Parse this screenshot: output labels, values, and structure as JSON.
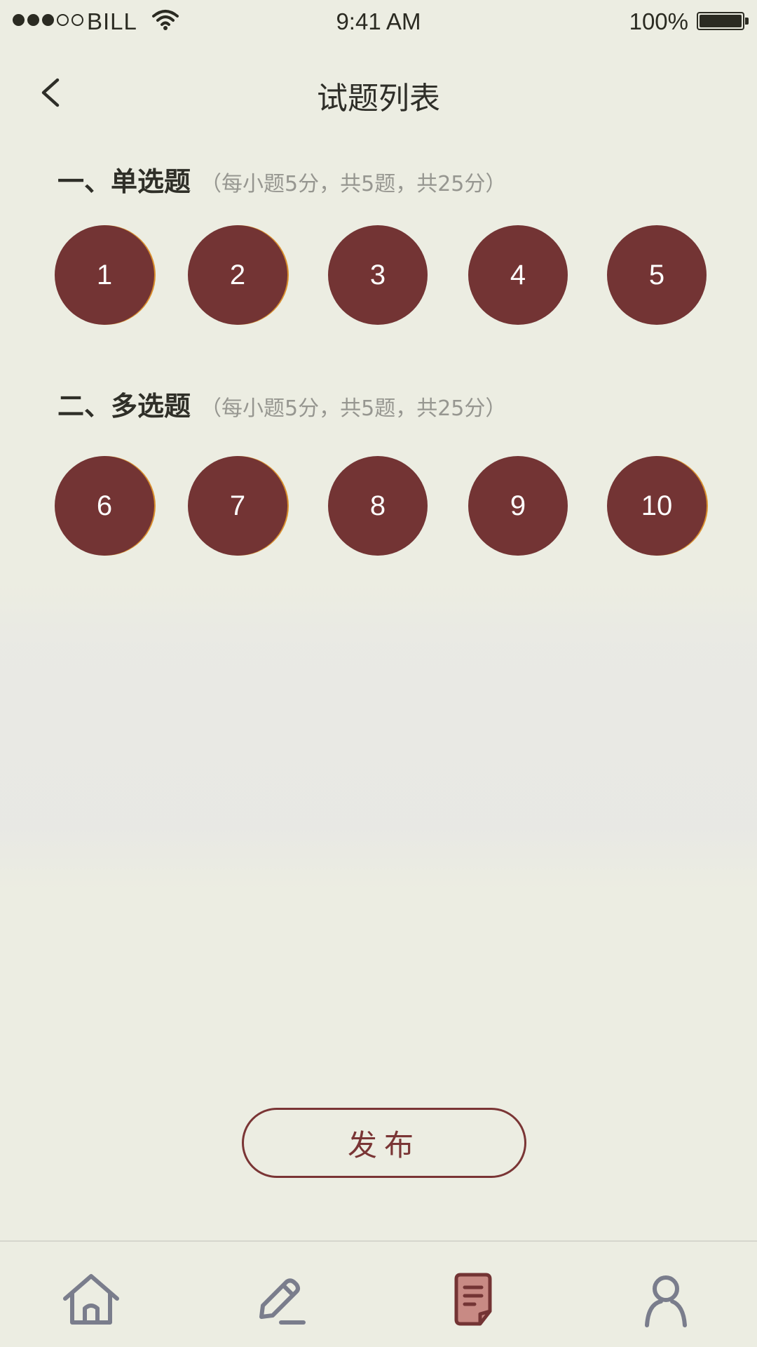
{
  "status_bar": {
    "carrier": "BILL",
    "time": "9:41 AM",
    "battery": "100%"
  },
  "header": {
    "title": "试题列表"
  },
  "sections": [
    {
      "name": "一、单选题",
      "note": "（每小题5分，共5题，共25分）",
      "questions": [
        "1",
        "2",
        "3",
        "4",
        "5"
      ]
    },
    {
      "name": "二、多选题",
      "note": "（每小题5分，共5题，共25分）",
      "questions": [
        "6",
        "7",
        "8",
        "9",
        "10"
      ]
    }
  ],
  "publish_label": "发布",
  "tab_bar": {
    "items": [
      {
        "icon": "home-icon",
        "active": false
      },
      {
        "icon": "edit-icon",
        "active": false
      },
      {
        "icon": "document-icon",
        "active": true
      },
      {
        "icon": "user-icon",
        "active": false
      }
    ]
  },
  "colors": {
    "background": "#ecede2",
    "accent": "#733434",
    "ring": "#d98f2e",
    "icon_inactive": "#7a7d8c"
  }
}
